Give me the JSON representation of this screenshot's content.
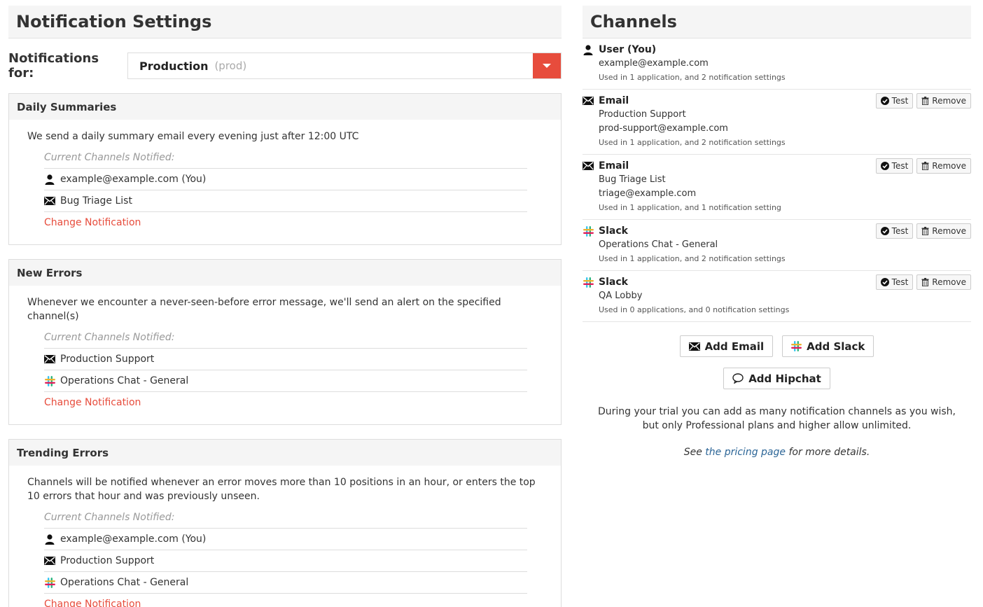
{
  "left": {
    "title": "Notification Settings",
    "notifications_for": {
      "label": "Notifications for:",
      "selected_value": "Production",
      "selected_sub": "(prod)"
    },
    "panels": [
      {
        "title": "Daily Summaries",
        "description": "We send a daily summary email every evening just after 12:00 UTC",
        "caption": "Current Channels Notified:",
        "items": [
          {
            "icon": "user-icon",
            "label": "example@example.com (You)"
          },
          {
            "icon": "envelope-icon",
            "label": "Bug Triage List"
          }
        ],
        "change_label": "Change Notification"
      },
      {
        "title": "New Errors",
        "description": "Whenever we encounter a never-seen-before error message, we'll send an alert on the specified channel(s)",
        "caption": "Current Channels Notified:",
        "items": [
          {
            "icon": "envelope-icon",
            "label": "Production Support"
          },
          {
            "icon": "slack-icon",
            "label": "Operations Chat - General"
          }
        ],
        "change_label": "Change Notification"
      },
      {
        "title": "Trending Errors",
        "description": "Channels will be notified whenever an error moves more than 10 positions in an hour, or enters the top 10 errors that hour and was previously unseen.",
        "caption": "Current Channels Notified:",
        "items": [
          {
            "icon": "user-icon",
            "label": "example@example.com (You)"
          },
          {
            "icon": "envelope-icon",
            "label": "Production Support"
          },
          {
            "icon": "slack-icon",
            "label": "Operations Chat - General"
          }
        ],
        "change_label": "Change Notification"
      }
    ]
  },
  "right": {
    "title": "Channels",
    "channels": [
      {
        "icon": "user-icon",
        "type": "User (You)",
        "lines": [
          "example@example.com"
        ],
        "usage": "Used in 1 application, and 2 notification settings",
        "actions": false
      },
      {
        "icon": "envelope-icon",
        "type": "Email",
        "lines": [
          "Production Support",
          "prod-support@example.com"
        ],
        "usage": "Used in 1 application, and 2 notification settings",
        "actions": true
      },
      {
        "icon": "envelope-icon",
        "type": "Email",
        "lines": [
          "Bug Triage List",
          "triage@example.com"
        ],
        "usage": "Used in 1 application, and 1 notification setting",
        "actions": true
      },
      {
        "icon": "slack-icon",
        "type": "Slack",
        "lines": [
          "Operations Chat - General"
        ],
        "usage": "Used in 1 application, and 2 notification settings",
        "actions": true
      },
      {
        "icon": "slack-icon",
        "type": "Slack",
        "lines": [
          "QA Lobby"
        ],
        "usage": "Used in 0 applications, and 0 notification settings",
        "actions": true
      }
    ],
    "test_label": "Test",
    "remove_label": "Remove",
    "add_email_label": "Add Email",
    "add_slack_label": "Add Slack",
    "add_hipchat_label": "Add Hipchat",
    "trial_note": "During your trial you can add as many notification channels as you wish, but only Professional plans and higher allow unlimited.",
    "pricing_prefix": "See ",
    "pricing_link": "the pricing page",
    "pricing_suffix": " for more details."
  },
  "colors": {
    "accent_red": "#e74c3c",
    "link_blue": "#2a6496"
  }
}
